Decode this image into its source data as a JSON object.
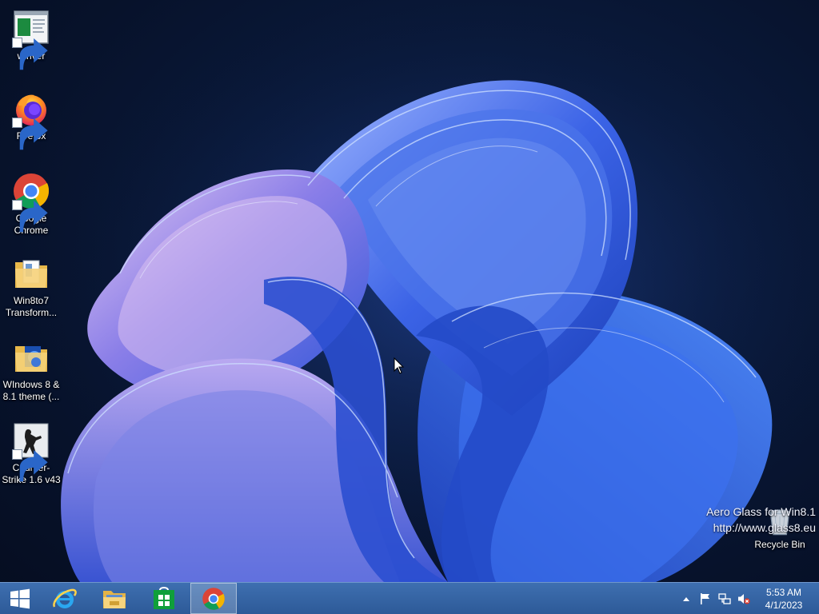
{
  "desktop": {
    "icons": [
      {
        "label": "winver",
        "icon": "winver-window-icon",
        "shortcut": true
      },
      {
        "label": "Firefox",
        "icon": "firefox-icon",
        "shortcut": true
      },
      {
        "label": "Google Chrome",
        "icon": "chrome-icon",
        "shortcut": true
      },
      {
        "label": "Win8to7 Transform...",
        "icon": "folder-icon",
        "shortcut": false
      },
      {
        "label": "WIndows 8 & 8.1 theme (...",
        "icon": "folder-theme-icon",
        "shortcut": false
      },
      {
        "label": "Counter-Strike 1.6 v43",
        "icon": "counter-strike-icon",
        "shortcut": true
      },
      {
        "label": "Recycle Bin",
        "icon": "recycle-bin-icon",
        "shortcut": false
      }
    ],
    "watermark": {
      "line1": "Aero Glass for Win8.1",
      "line2": "http://www.glass8.eu"
    }
  },
  "taskbar": {
    "start": {
      "icon": "windows-logo-icon"
    },
    "pinned": [
      {
        "name": "Internet Explorer",
        "icon": "internet-explorer-icon",
        "active": false
      },
      {
        "name": "File Explorer",
        "icon": "file-explorer-icon",
        "active": false
      },
      {
        "name": "Store",
        "icon": "store-icon",
        "active": false
      },
      {
        "name": "Google Chrome",
        "icon": "chrome-icon",
        "active": true
      }
    ],
    "tray": {
      "icons": [
        "show-hidden-icons-arrow-icon",
        "action-center-flag-icon",
        "network-icon",
        "volume-muted-icon"
      ],
      "time": "5:53 AM",
      "date": "4/1/2023"
    }
  },
  "colors": {
    "taskbar": "#3565a4",
    "desktop_background": "#07122b",
    "bloom_primary": "#2f63e0",
    "bloom_highlight": "#c9b3f0"
  }
}
